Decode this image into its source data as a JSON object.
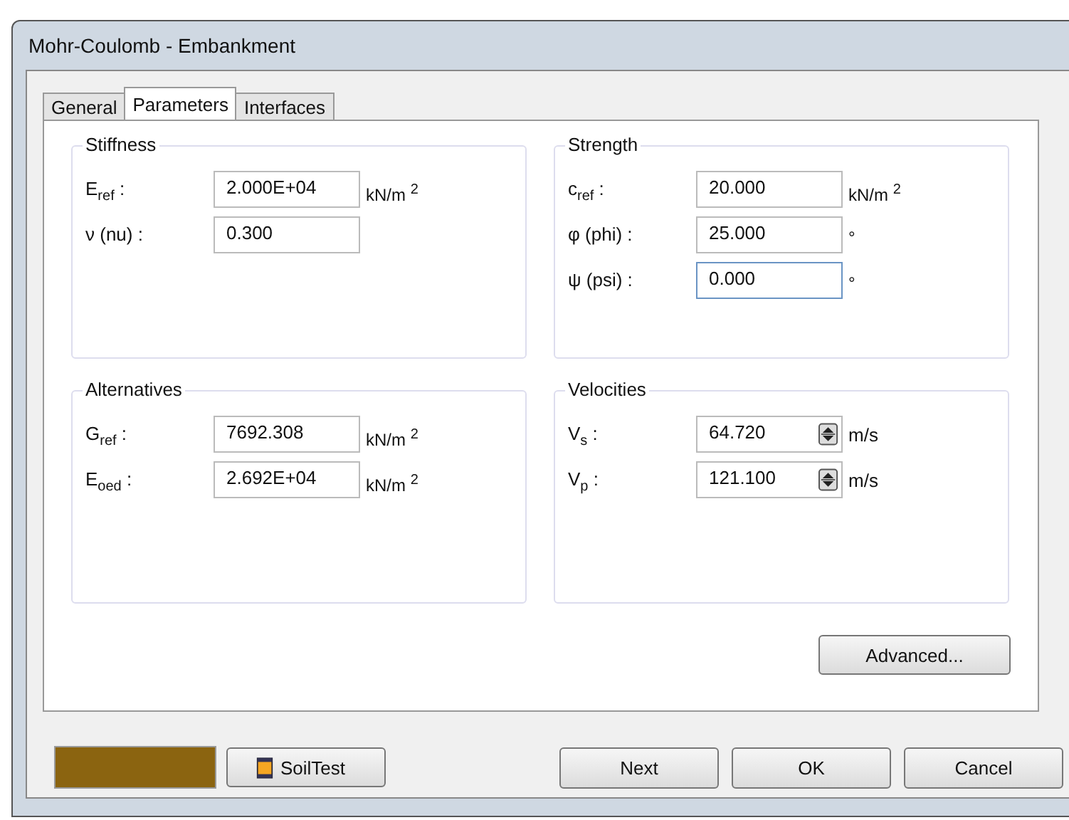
{
  "window": {
    "title": "Mohr-Coulomb - Embankment"
  },
  "tabs": [
    {
      "label": "General",
      "selected": false
    },
    {
      "label": "Parameters",
      "selected": true
    },
    {
      "label": "Interfaces",
      "selected": false
    }
  ],
  "groups": [
    {
      "title": "Stiffness",
      "fields": [
        {
          "label": "E$_{ref}$ :",
          "value": "2.000E+04",
          "unit": "kN/m $^{2}$",
          "kind": "text",
          "focused": false
        },
        {
          "label": "ν (nu) :",
          "value": "0.300",
          "kind": "text",
          "focused": false
        }
      ]
    },
    {
      "title": "Strength",
      "fields": [
        {
          "label": "c$_{ref}$ :",
          "value": "20.000",
          "unit": "kN/m $^{2}$",
          "kind": "text",
          "focused": false
        },
        {
          "label": "φ (phi) :",
          "value": "25.000",
          "unit": "°",
          "kind": "text",
          "focused": false
        },
        {
          "label": "ψ (psi) :",
          "value": "0.000",
          "unit": "°",
          "kind": "text",
          "focused": true
        }
      ]
    },
    {
      "title": "Alternatives",
      "fields": [
        {
          "label": "G$_{ref}$ :",
          "value": "7692.308",
          "unit": "kN/m $^{2}$",
          "kind": "text",
          "focused": false
        },
        {
          "label": "E$_{oed}$ :",
          "value": "2.692E+04",
          "unit": "kN/m $^{2}$",
          "kind": "text",
          "focused": false
        }
      ]
    },
    {
      "title": "Velocities",
      "fields": [
        {
          "label": "V$_{s}$ :",
          "value": "64.720",
          "unit": "m/s",
          "kind": "spin",
          "focused": false
        },
        {
          "label": "V$_{p}$ :",
          "value": "121.100",
          "unit": "m/s",
          "kind": "spin",
          "focused": false
        }
      ]
    }
  ],
  "advanced_button": "Advanced...",
  "material_color": {
    "color": "#8b6410"
  },
  "soiltest_button": "SoilTest",
  "buttons": [
    "Next",
    "OK",
    "Cancel"
  ]
}
